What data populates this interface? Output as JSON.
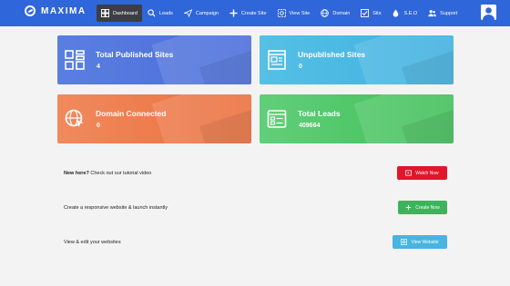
{
  "brand": {
    "name": "MAXIMA"
  },
  "nav": [
    {
      "label": "Dashboard",
      "icon": "dashboard-icon"
    },
    {
      "label": "Leads",
      "icon": "search-icon"
    },
    {
      "label": "Campaign",
      "icon": "send-icon"
    },
    {
      "label": "Create Site",
      "icon": "plus-icon"
    },
    {
      "label": "View Site",
      "icon": "view-site-icon"
    },
    {
      "label": "Domain",
      "icon": "globe-icon"
    },
    {
      "label": "Sits",
      "icon": "checkbox-icon"
    },
    {
      "label": "S.E.O",
      "icon": "drop-icon"
    },
    {
      "label": "Support",
      "icon": "users-icon"
    }
  ],
  "cards": [
    {
      "title": "Total Published Sites",
      "value": "4",
      "icon": "grid-icon",
      "color": "#4f73dc"
    },
    {
      "title": "Unpublished Sites",
      "value": "0",
      "icon": "document-icon",
      "color": "#4ab8e2"
    },
    {
      "title": "Domain Connected",
      "value": "0",
      "icon": "globe-cursor-icon",
      "color": "#ed7b4a"
    },
    {
      "title": "Total Leads",
      "value": "409664",
      "icon": "form-icon",
      "color": "#4cc566"
    }
  ],
  "rows": {
    "tutorial": {
      "bold": "New here?",
      "text": " Check out our tutorial video",
      "button": "Watch Now",
      "button_color": "#e3152b"
    },
    "create": {
      "text": "Create a responsive website & launch instantly",
      "button": "Create Now",
      "button_color": "#3cb55a"
    },
    "view": {
      "text": "View & edit your websites",
      "button": "View Website",
      "button_color": "#48b4e0"
    }
  }
}
